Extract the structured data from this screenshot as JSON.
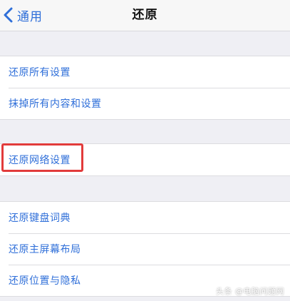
{
  "nav": {
    "back_label": "通用",
    "title": "还原"
  },
  "groups": [
    {
      "items": [
        "还原所有设置",
        "抹掉所有内容和设置"
      ]
    },
    {
      "items": [
        "还原网络设置"
      ]
    },
    {
      "items": [
        "还原键盘词典",
        "还原主屏幕布局",
        "还原位置与隐私"
      ]
    }
  ],
  "watermark": "头条 @电脑问题网",
  "colors": {
    "accent": "#2f6fd9",
    "highlight": "#e23b3b",
    "background": "#efeff4"
  }
}
